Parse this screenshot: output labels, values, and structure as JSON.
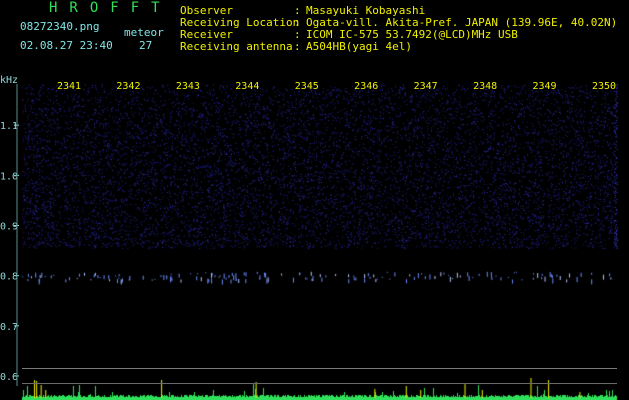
{
  "header": {
    "brand": "HROFFT",
    "filename": "08272340.png",
    "datetime": "02.08.27 23:40",
    "meteor_label": "meteor",
    "meteor_count": "27"
  },
  "info": [
    {
      "label": "Observer",
      "value": "Masayuki Kobayashi"
    },
    {
      "label": "Receiving Location",
      "value": "Ogata-vill. Akita-Pref. JAPAN (139.96E, 40.02N)"
    },
    {
      "label": "Receiver",
      "value": "ICOM IC-575 53.7492(@LCD)MHz USB"
    },
    {
      "label": "Receiving antenna",
      "value": "A504HB(yagi 4el)"
    }
  ],
  "colors": {
    "label_text": "#7fe6e6",
    "value_text": "#f0f000",
    "brand_text": "#2fe05a",
    "axis": "#8fdada",
    "noise": "#1c1c88",
    "echo": "#6a8cff",
    "signal_band": "#2fe05a"
  },
  "chart_data": {
    "type": "heatmap",
    "y_unit": "kHz",
    "y_ticks": [
      "1.1",
      "1.0",
      "0.9",
      "0.8",
      "0.7",
      "0.6"
    ],
    "x_ticks": [
      "2341",
      "2342",
      "2343",
      "2344",
      "2345",
      "2346",
      "2347",
      "2348",
      "2349",
      "2350"
    ],
    "ylim": [
      0.58,
      1.2
    ]
  }
}
